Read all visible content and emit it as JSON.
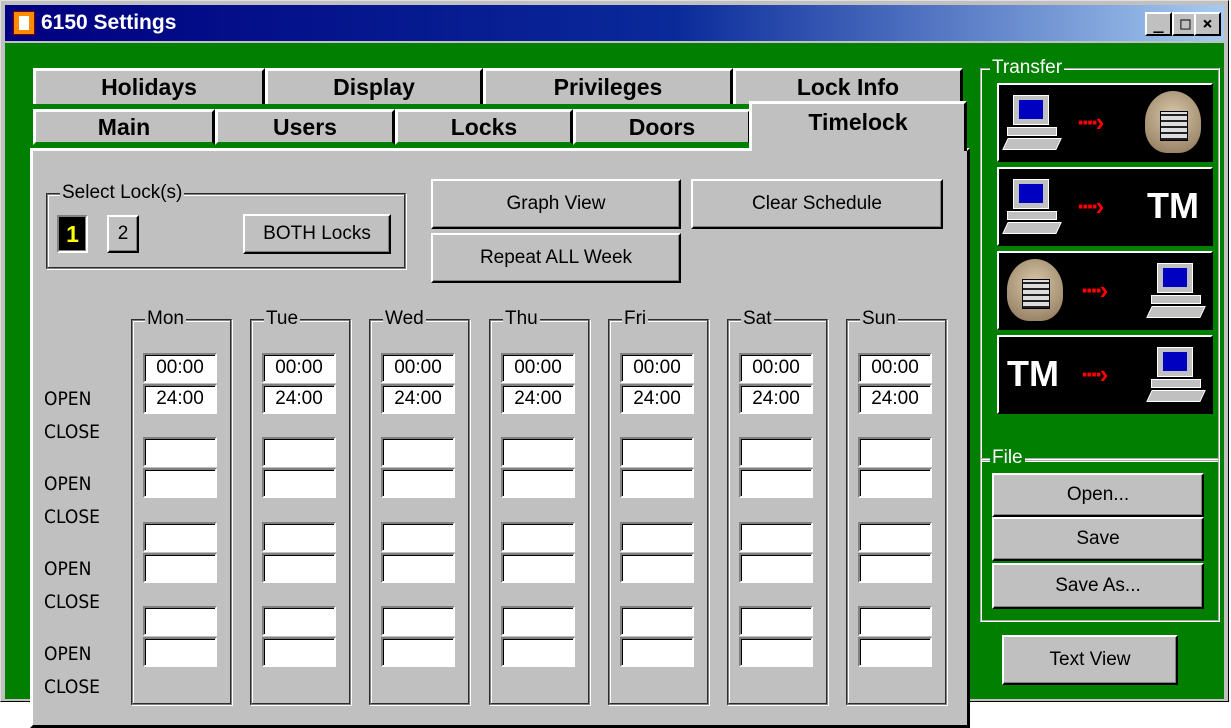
{
  "window": {
    "title": "6150 Settings",
    "controls": {
      "minimize": "_",
      "maximize": "□",
      "close": "×"
    }
  },
  "tabs": {
    "back_row": [
      "Holidays",
      "Display",
      "Privileges",
      "Lock Info"
    ],
    "front_row": [
      "Main",
      "Users",
      "Locks",
      "Doors",
      "Timelock"
    ],
    "active": "Timelock"
  },
  "select_lock": {
    "label": "Select Lock(s)",
    "lock1": "1",
    "lock2": "2",
    "both": "BOTH Locks",
    "selected": "1"
  },
  "actions": {
    "graph_view": "Graph View",
    "clear_schedule": "Clear Schedule",
    "repeat_all_week": "Repeat ALL Week"
  },
  "row_labels": {
    "open": "OPEN",
    "close": "CLOSE"
  },
  "days": [
    {
      "label": "Mon",
      "times": [
        "00:00",
        "24:00",
        "",
        "",
        "",
        "",
        "",
        ""
      ]
    },
    {
      "label": "Tue",
      "times": [
        "00:00",
        "24:00",
        "",
        "",
        "",
        "",
        "",
        ""
      ]
    },
    {
      "label": "Wed",
      "times": [
        "00:00",
        "24:00",
        "",
        "",
        "",
        "",
        "",
        ""
      ]
    },
    {
      "label": "Thu",
      "times": [
        "00:00",
        "24:00",
        "",
        "",
        "",
        "",
        "",
        ""
      ]
    },
    {
      "label": "Fri",
      "times": [
        "00:00",
        "24:00",
        "",
        "",
        "",
        "",
        "",
        ""
      ]
    },
    {
      "label": "Sat",
      "times": [
        "00:00",
        "24:00",
        "",
        "",
        "",
        "",
        "",
        ""
      ]
    },
    {
      "label": "Sun",
      "times": [
        "00:00",
        "24:00",
        "",
        "",
        "",
        "",
        "",
        ""
      ]
    }
  ],
  "transfer": {
    "label": "Transfer",
    "buttons": [
      {
        "from": "computer-icon",
        "to": "lock-keypad-icon"
      },
      {
        "from": "computer-icon",
        "to": "TM"
      },
      {
        "from": "lock-keypad-icon",
        "to": "computer-icon"
      },
      {
        "from": "TM",
        "to": "computer-icon"
      }
    ]
  },
  "file": {
    "label": "File",
    "open": "Open...",
    "save": "Save",
    "save_as": "Save As..."
  },
  "text_view": "Text View",
  "colors": {
    "window_bg": "#007f00",
    "face": "#c0c0c0",
    "arrow": "#ff0000",
    "titlebar": "#000080"
  }
}
